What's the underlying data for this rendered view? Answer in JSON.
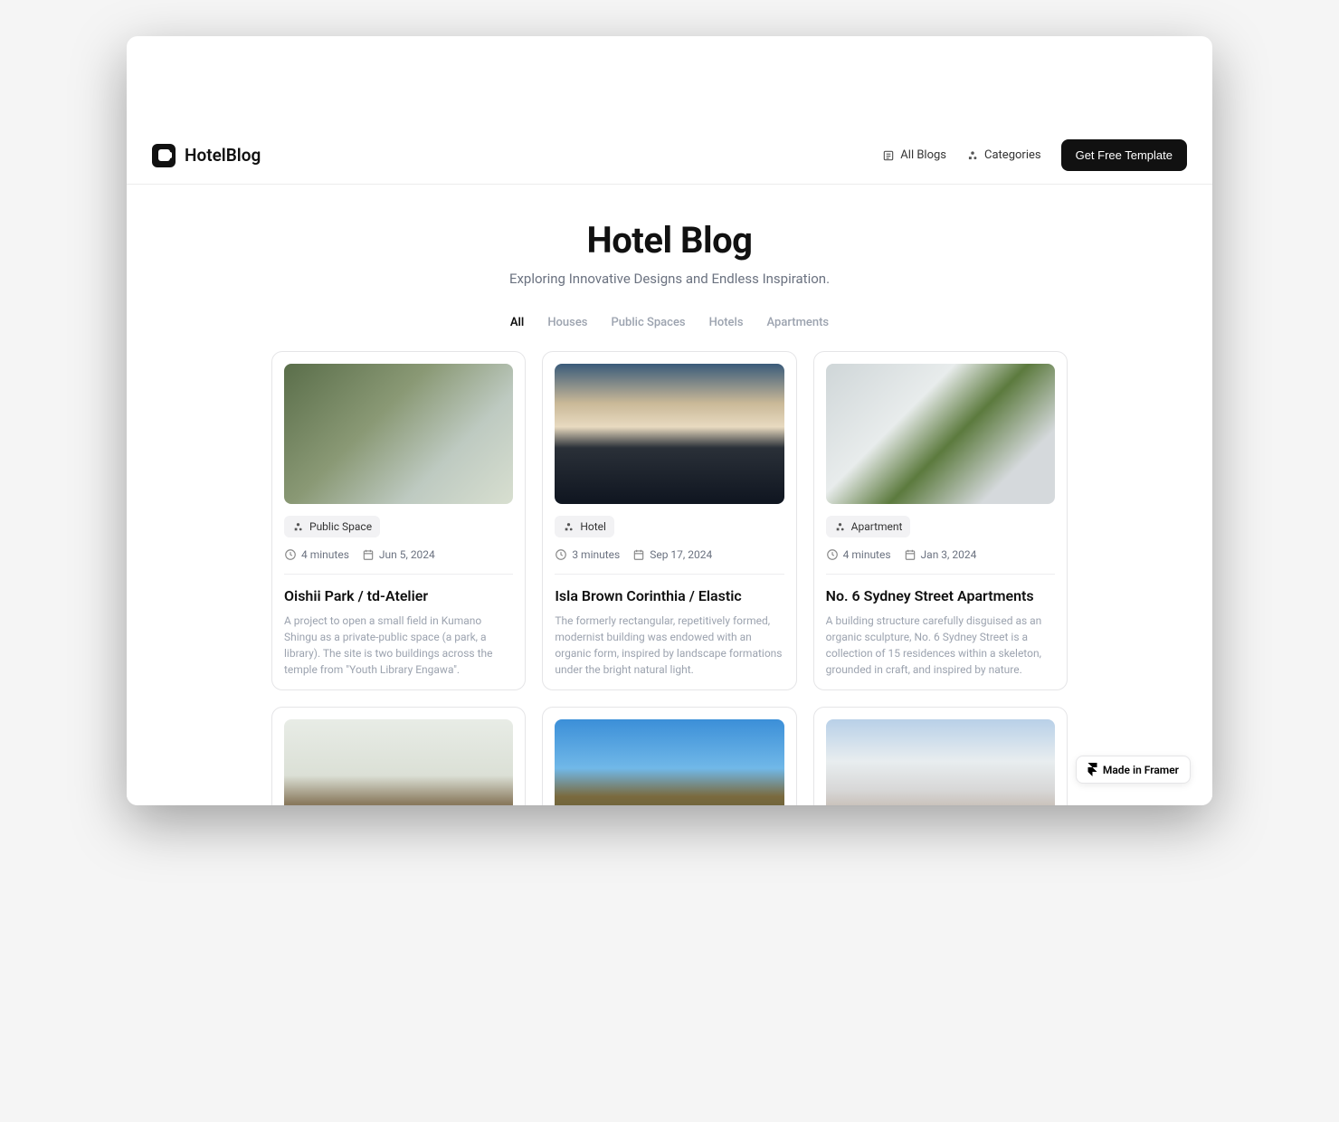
{
  "header": {
    "brand": "HotelBlog",
    "nav": {
      "all_blogs": "All Blogs",
      "categories": "Categories"
    },
    "cta": "Get Free Template"
  },
  "hero": {
    "title": "Hotel Blog",
    "subtitle": "Exploring Innovative Designs and Endless Inspiration."
  },
  "tabs": [
    "All",
    "Houses",
    "Public Spaces",
    "Hotels",
    "Apartments"
  ],
  "active_tab": 0,
  "cards": [
    {
      "badge": "Public Space",
      "read_time": "4 minutes",
      "date": "Jun 5, 2024",
      "title": "Oishii Park / td-Atelier",
      "desc": "A project to open a small field in Kumano Shingu as a private-public space (a park, a library). The site is two buildings across the temple from \"Youth Library Engawa\"."
    },
    {
      "badge": "Hotel",
      "read_time": "3 minutes",
      "date": "Sep 17, 2024",
      "title": "Isla Brown Corinthia / Elastic",
      "desc": "The formerly rectangular, repetitively formed, modernist building was endowed with an organic form, inspired by landscape formations under the bright natural light."
    },
    {
      "badge": "Apartment",
      "read_time": "4 minutes",
      "date": "Jan 3, 2024",
      "title": "No. 6 Sydney Street Apartments",
      "desc": "A building structure carefully disguised as an organic sculpture, No. 6 Sydney Street is a collection of 15 residences within a skeleton, grounded in craft, and inspired by nature."
    }
  ],
  "framer_badge": "Made in Framer"
}
